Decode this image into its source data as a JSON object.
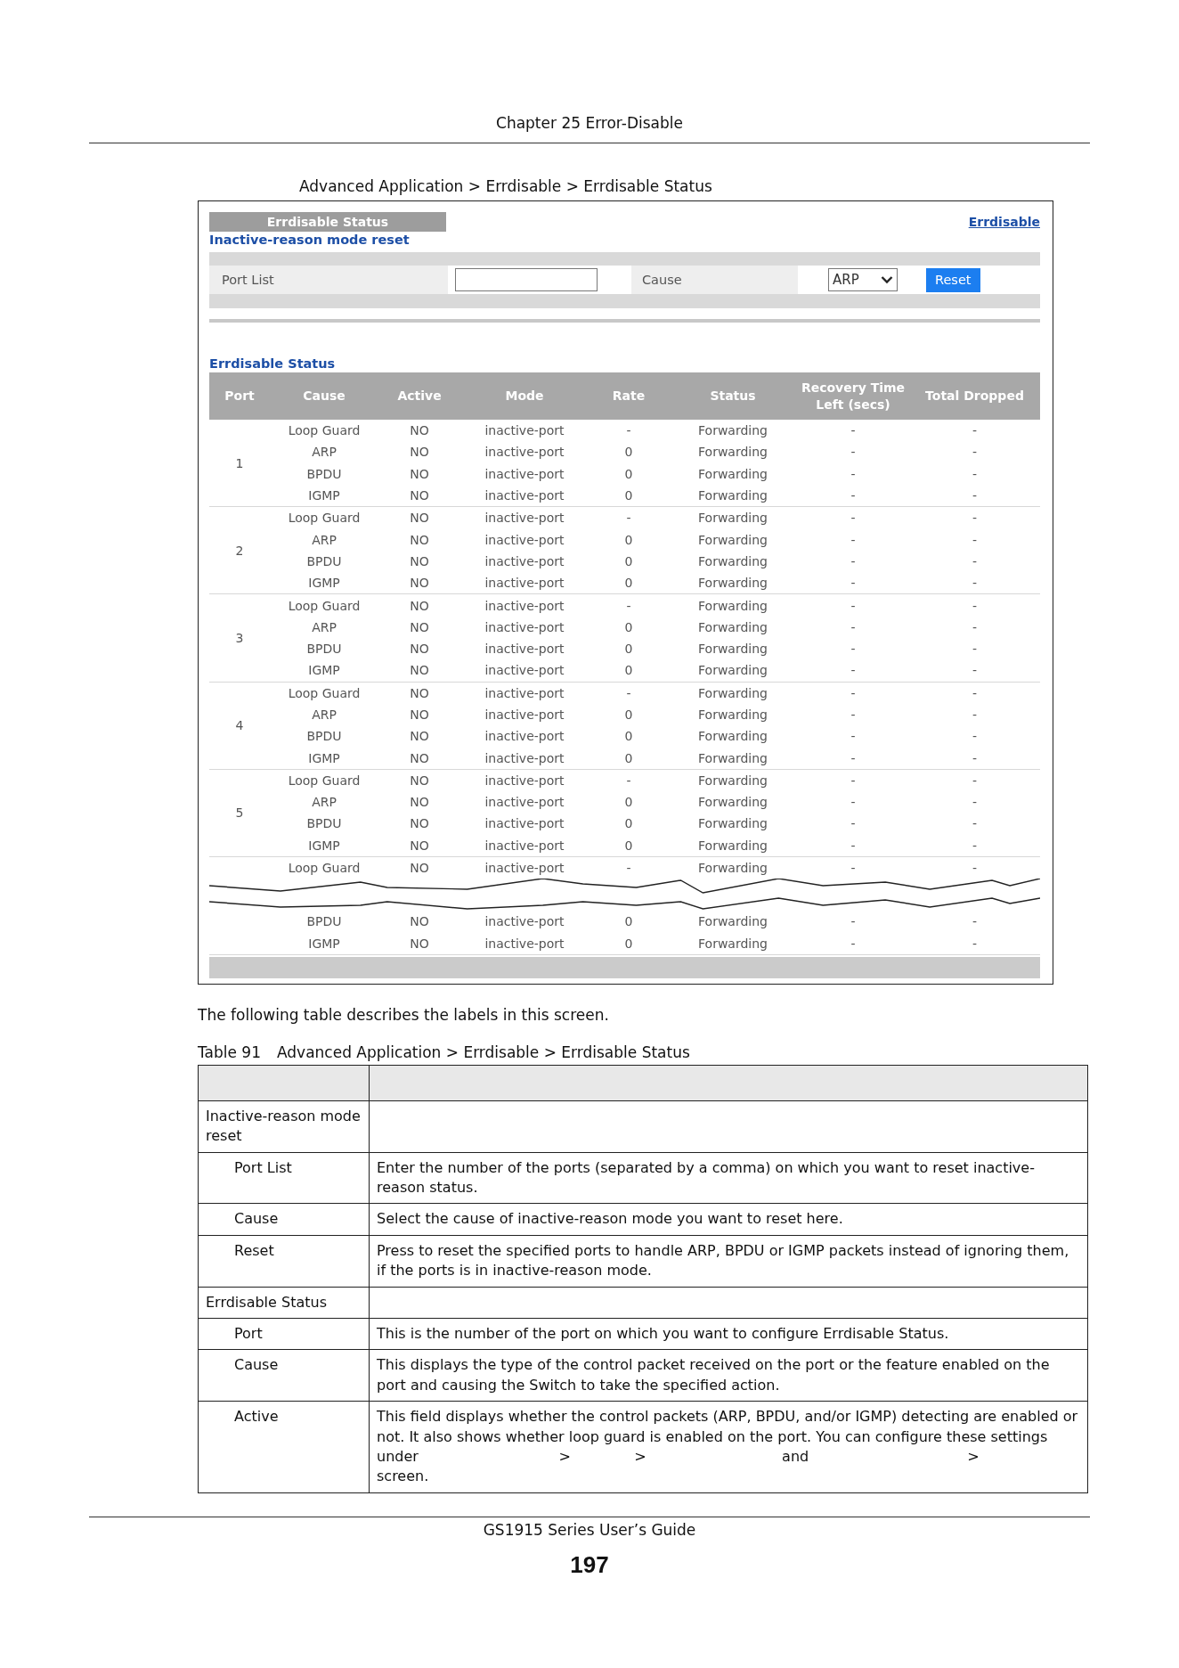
{
  "page_header": {
    "chapter": "Chapter 25 Error-Disable"
  },
  "figure_caption": "Advanced Application > Errdisable > Errdisable Status",
  "screen": {
    "title_tab": "Errdisable Status",
    "link": "Errdisable",
    "reset_section": {
      "title": "Inactive-reason mode reset",
      "port_list_label": "Port List",
      "cause_label": "Cause",
      "cause_value": "ARP",
      "button": "Reset"
    },
    "status_section": {
      "title": "Errdisable Status",
      "columns": [
        "Port",
        "Cause",
        "Active",
        "Mode",
        "Rate",
        "Status",
        "Recovery Time Left (secs)",
        "Total Dropped"
      ],
      "groups": [
        {
          "port": "1",
          "rows": [
            {
              "kind": "row",
              "cells": [
                "Loop Guard",
                "NO",
                "inactive-port",
                "-",
                "Forwarding",
                "-",
                "-"
              ]
            },
            {
              "kind": "row",
              "cells": [
                "ARP",
                "NO",
                "inactive-port",
                "0",
                "Forwarding",
                "-",
                "-"
              ]
            },
            {
              "kind": "row",
              "cells": [
                "BPDU",
                "NO",
                "inactive-port",
                "0",
                "Forwarding",
                "-",
                "-"
              ]
            },
            {
              "kind": "row",
              "cells": [
                "IGMP",
                "NO",
                "inactive-port",
                "0",
                "Forwarding",
                "-",
                "-"
              ]
            }
          ]
        },
        {
          "port": "2",
          "rows": [
            {
              "kind": "row",
              "cells": [
                "Loop Guard",
                "NO",
                "inactive-port",
                "-",
                "Forwarding",
                "-",
                "-"
              ]
            },
            {
              "kind": "row",
              "cells": [
                "ARP",
                "NO",
                "inactive-port",
                "0",
                "Forwarding",
                "-",
                "-"
              ]
            },
            {
              "kind": "row",
              "cells": [
                "BPDU",
                "NO",
                "inactive-port",
                "0",
                "Forwarding",
                "-",
                "-"
              ]
            },
            {
              "kind": "row",
              "cells": [
                "IGMP",
                "NO",
                "inactive-port",
                "0",
                "Forwarding",
                "-",
                "-"
              ]
            }
          ]
        },
        {
          "port": "3",
          "rows": [
            {
              "kind": "row",
              "cells": [
                "Loop Guard",
                "NO",
                "inactive-port",
                "-",
                "Forwarding",
                "-",
                "-"
              ]
            },
            {
              "kind": "row",
              "cells": [
                "ARP",
                "NO",
                "inactive-port",
                "0",
                "Forwarding",
                "-",
                "-"
              ]
            },
            {
              "kind": "row",
              "cells": [
                "BPDU",
                "NO",
                "inactive-port",
                "0",
                "Forwarding",
                "-",
                "-"
              ]
            },
            {
              "kind": "row",
              "cells": [
                "IGMP",
                "NO",
                "inactive-port",
                "0",
                "Forwarding",
                "-",
                "-"
              ]
            }
          ]
        },
        {
          "port": "4",
          "rows": [
            {
              "kind": "row",
              "cells": [
                "Loop Guard",
                "NO",
                "inactive-port",
                "-",
                "Forwarding",
                "-",
                "-"
              ]
            },
            {
              "kind": "row",
              "cells": [
                "ARP",
                "NO",
                "inactive-port",
                "0",
                "Forwarding",
                "-",
                "-"
              ]
            },
            {
              "kind": "row",
              "cells": [
                "BPDU",
                "NO",
                "inactive-port",
                "0",
                "Forwarding",
                "-",
                "-"
              ]
            },
            {
              "kind": "row",
              "cells": [
                "IGMP",
                "NO",
                "inactive-port",
                "0",
                "Forwarding",
                "-",
                "-"
              ]
            }
          ]
        },
        {
          "port": "5",
          "rows": [
            {
              "kind": "row",
              "cells": [
                "Loop Guard",
                "NO",
                "inactive-port",
                "-",
                "Forwarding",
                "-",
                "-"
              ]
            },
            {
              "kind": "row",
              "cells": [
                "ARP",
                "NO",
                "inactive-port",
                "0",
                "Forwarding",
                "-",
                "-"
              ]
            },
            {
              "kind": "row",
              "cells": [
                "BPDU",
                "NO",
                "inactive-port",
                "0",
                "Forwarding",
                "-",
                "-"
              ]
            },
            {
              "kind": "row",
              "cells": [
                "IGMP",
                "NO",
                "inactive-port",
                "0",
                "Forwarding",
                "-",
                "-"
              ]
            }
          ]
        },
        {
          "rows": [
            {
              "kind": "row",
              "cells": [
                "Loop Guard",
                "NO",
                "inactive-port",
                "-",
                "Forwarding",
                "-",
                "-"
              ]
            },
            {
              "kind": "break"
            },
            {
              "kind": "row",
              "cells": [
                "BPDU",
                "NO",
                "inactive-port",
                "0",
                "Forwarding",
                "-",
                "-"
              ]
            },
            {
              "kind": "row",
              "cells": [
                "IGMP",
                "NO",
                "inactive-port",
                "0",
                "Forwarding",
                "-",
                "-"
              ]
            }
          ]
        }
      ]
    }
  },
  "intro": "The following table describes the labels in this screen.",
  "table_caption": {
    "number": "Table 91",
    "title": "Advanced Application > Errdisable > Errdisable Status"
  },
  "label_table": {
    "rows": [
      {
        "kind": "section",
        "label": "Inactive-reason mode reset"
      },
      {
        "kind": "field",
        "label": "Port List",
        "description": "Enter the number of the ports (separated by a comma) on which you want to reset inactive-reason status."
      },
      {
        "kind": "field",
        "label": "Cause",
        "description": "Select the cause of inactive-reason mode you want to reset here."
      },
      {
        "kind": "field",
        "label": "Reset",
        "description": "Press to reset the specified ports to handle ARP, BPDU or IGMP packets instead of ignoring them, if the ports is in inactive-reason mode."
      },
      {
        "kind": "section",
        "label": "Errdisable Status"
      },
      {
        "kind": "field",
        "label": "Port",
        "description": "This is the number of the port on which you want to configure Errdisable Status."
      },
      {
        "kind": "field",
        "label": "Cause",
        "description": "This displays the type of the control packet received on the port or the feature enabled on the port and causing the Switch to take the specified action."
      },
      {
        "kind": "field",
        "label": "Active",
        "description": "This field displays whether the control packets (ARP, BPDU, and/or IGMP) detecting are enabled or not. It also shows whether loop guard is enabled on the port. You can configure these settings under                               >              >                              and                                   >           screen."
      }
    ]
  },
  "footer": {
    "guide": "GS1915 Series User’s Guide",
    "page_number": "197"
  }
}
